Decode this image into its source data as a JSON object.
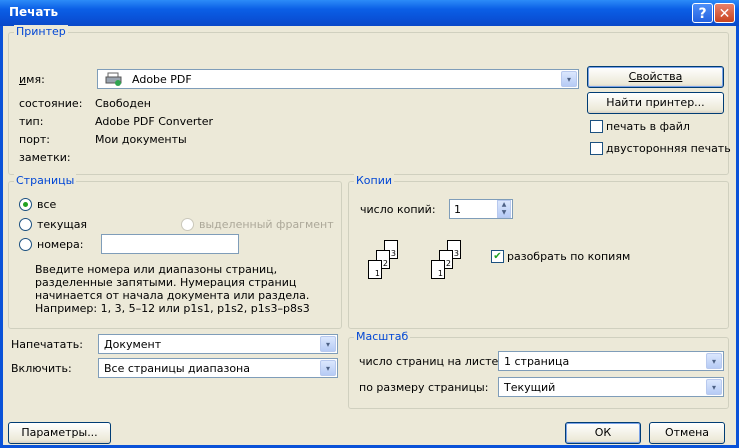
{
  "window": {
    "title": "Печать"
  },
  "printer": {
    "legend": "Принтер",
    "name_label": "имя:",
    "name_value": "Adobe PDF",
    "status_label": "состояние:",
    "status_value": "Свободен",
    "type_label": "тип:",
    "type_value": "Adobe PDF Converter",
    "port_label": "порт:",
    "port_value": "Мои документы",
    "notes_label": "заметки:",
    "properties_button": "Свойства",
    "find_printer_button": "Найти принтер...",
    "print_to_file": "печать в файл",
    "duplex": "двусторонняя печать"
  },
  "pages": {
    "legend": "Страницы",
    "all": "все",
    "current": "текущая",
    "selection": "выделенный фрагмент",
    "numbers": "номера:",
    "hint": [
      "Введите номера или диапазоны страниц,",
      "разделенные запятыми. Нумерация страниц",
      "начинается от начала документа или раздела.",
      "Например: 1, 3, 5–12 или p1s1, p1s2, p1s3–p8s3"
    ]
  },
  "copies": {
    "legend": "Копии",
    "count_label": "число копий:",
    "count_value": "1",
    "collate": "разобрать по копиям",
    "page_nums": [
      "1",
      "2",
      "3"
    ]
  },
  "print_what": {
    "label": "Напечатать:",
    "value": "Документ"
  },
  "include": {
    "label": "Включить:",
    "value": "Все страницы диапазона"
  },
  "zoom": {
    "legend": "Масштаб",
    "pages_per_sheet_label": "число страниц на листе:",
    "pages_per_sheet_value": "1 страница",
    "scale_label": "по размеру страницы:",
    "scale_value": "Текущий"
  },
  "footer": {
    "options": "Параметры...",
    "ok": "ОК",
    "cancel": "Отмена"
  },
  "icons": {
    "dropdown": "▾",
    "check": "✔",
    "help": "?",
    "close": "✕"
  }
}
